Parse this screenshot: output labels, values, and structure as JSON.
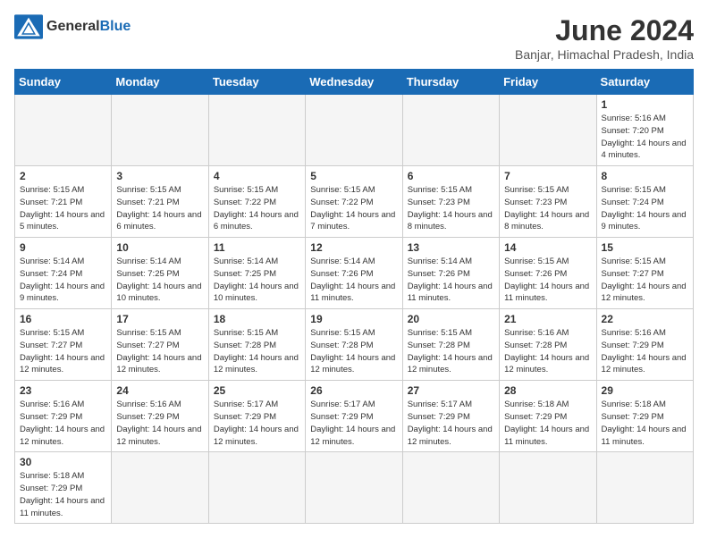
{
  "header": {
    "logo_general": "General",
    "logo_blue": "Blue",
    "month_year": "June 2024",
    "location": "Banjar, Himachal Pradesh, India"
  },
  "days_of_week": [
    "Sunday",
    "Monday",
    "Tuesday",
    "Wednesday",
    "Thursday",
    "Friday",
    "Saturday"
  ],
  "weeks": [
    [
      {
        "day": "",
        "sunrise": "",
        "sunset": "",
        "daylight": "",
        "empty": true
      },
      {
        "day": "",
        "sunrise": "",
        "sunset": "",
        "daylight": "",
        "empty": true
      },
      {
        "day": "",
        "sunrise": "",
        "sunset": "",
        "daylight": "",
        "empty": true
      },
      {
        "day": "",
        "sunrise": "",
        "sunset": "",
        "daylight": "",
        "empty": true
      },
      {
        "day": "",
        "sunrise": "",
        "sunset": "",
        "daylight": "",
        "empty": true
      },
      {
        "day": "",
        "sunrise": "",
        "sunset": "",
        "daylight": "",
        "empty": true
      },
      {
        "day": "1",
        "sunrise": "5:16 AM",
        "sunset": "7:20 PM",
        "daylight": "14 hours and 4 minutes.",
        "empty": false
      }
    ],
    [
      {
        "day": "2",
        "sunrise": "5:15 AM",
        "sunset": "7:21 PM",
        "daylight": "14 hours and 5 minutes.",
        "empty": false
      },
      {
        "day": "3",
        "sunrise": "5:15 AM",
        "sunset": "7:21 PM",
        "daylight": "14 hours and 6 minutes.",
        "empty": false
      },
      {
        "day": "4",
        "sunrise": "5:15 AM",
        "sunset": "7:22 PM",
        "daylight": "14 hours and 6 minutes.",
        "empty": false
      },
      {
        "day": "5",
        "sunrise": "5:15 AM",
        "sunset": "7:22 PM",
        "daylight": "14 hours and 7 minutes.",
        "empty": false
      },
      {
        "day": "6",
        "sunrise": "5:15 AM",
        "sunset": "7:23 PM",
        "daylight": "14 hours and 8 minutes.",
        "empty": false
      },
      {
        "day": "7",
        "sunrise": "5:15 AM",
        "sunset": "7:23 PM",
        "daylight": "14 hours and 8 minutes.",
        "empty": false
      },
      {
        "day": "8",
        "sunrise": "5:15 AM",
        "sunset": "7:24 PM",
        "daylight": "14 hours and 9 minutes.",
        "empty": false
      }
    ],
    [
      {
        "day": "9",
        "sunrise": "5:14 AM",
        "sunset": "7:24 PM",
        "daylight": "14 hours and 9 minutes.",
        "empty": false
      },
      {
        "day": "10",
        "sunrise": "5:14 AM",
        "sunset": "7:25 PM",
        "daylight": "14 hours and 10 minutes.",
        "empty": false
      },
      {
        "day": "11",
        "sunrise": "5:14 AM",
        "sunset": "7:25 PM",
        "daylight": "14 hours and 10 minutes.",
        "empty": false
      },
      {
        "day": "12",
        "sunrise": "5:14 AM",
        "sunset": "7:26 PM",
        "daylight": "14 hours and 11 minutes.",
        "empty": false
      },
      {
        "day": "13",
        "sunrise": "5:14 AM",
        "sunset": "7:26 PM",
        "daylight": "14 hours and 11 minutes.",
        "empty": false
      },
      {
        "day": "14",
        "sunrise": "5:15 AM",
        "sunset": "7:26 PM",
        "daylight": "14 hours and 11 minutes.",
        "empty": false
      },
      {
        "day": "15",
        "sunrise": "5:15 AM",
        "sunset": "7:27 PM",
        "daylight": "14 hours and 12 minutes.",
        "empty": false
      }
    ],
    [
      {
        "day": "16",
        "sunrise": "5:15 AM",
        "sunset": "7:27 PM",
        "daylight": "14 hours and 12 minutes.",
        "empty": false
      },
      {
        "day": "17",
        "sunrise": "5:15 AM",
        "sunset": "7:27 PM",
        "daylight": "14 hours and 12 minutes.",
        "empty": false
      },
      {
        "day": "18",
        "sunrise": "5:15 AM",
        "sunset": "7:28 PM",
        "daylight": "14 hours and 12 minutes.",
        "empty": false
      },
      {
        "day": "19",
        "sunrise": "5:15 AM",
        "sunset": "7:28 PM",
        "daylight": "14 hours and 12 minutes.",
        "empty": false
      },
      {
        "day": "20",
        "sunrise": "5:15 AM",
        "sunset": "7:28 PM",
        "daylight": "14 hours and 12 minutes.",
        "empty": false
      },
      {
        "day": "21",
        "sunrise": "5:16 AM",
        "sunset": "7:28 PM",
        "daylight": "14 hours and 12 minutes.",
        "empty": false
      },
      {
        "day": "22",
        "sunrise": "5:16 AM",
        "sunset": "7:29 PM",
        "daylight": "14 hours and 12 minutes.",
        "empty": false
      }
    ],
    [
      {
        "day": "23",
        "sunrise": "5:16 AM",
        "sunset": "7:29 PM",
        "daylight": "14 hours and 12 minutes.",
        "empty": false
      },
      {
        "day": "24",
        "sunrise": "5:16 AM",
        "sunset": "7:29 PM",
        "daylight": "14 hours and 12 minutes.",
        "empty": false
      },
      {
        "day": "25",
        "sunrise": "5:17 AM",
        "sunset": "7:29 PM",
        "daylight": "14 hours and 12 minutes.",
        "empty": false
      },
      {
        "day": "26",
        "sunrise": "5:17 AM",
        "sunset": "7:29 PM",
        "daylight": "14 hours and 12 minutes.",
        "empty": false
      },
      {
        "day": "27",
        "sunrise": "5:17 AM",
        "sunset": "7:29 PM",
        "daylight": "14 hours and 12 minutes.",
        "empty": false
      },
      {
        "day": "28",
        "sunrise": "5:18 AM",
        "sunset": "7:29 PM",
        "daylight": "14 hours and 11 minutes.",
        "empty": false
      },
      {
        "day": "29",
        "sunrise": "5:18 AM",
        "sunset": "7:29 PM",
        "daylight": "14 hours and 11 minutes.",
        "empty": false
      }
    ],
    [
      {
        "day": "30",
        "sunrise": "5:18 AM",
        "sunset": "7:29 PM",
        "daylight": "14 hours and 11 minutes.",
        "empty": false
      },
      {
        "day": "",
        "sunrise": "",
        "sunset": "",
        "daylight": "",
        "empty": true
      },
      {
        "day": "",
        "sunrise": "",
        "sunset": "",
        "daylight": "",
        "empty": true
      },
      {
        "day": "",
        "sunrise": "",
        "sunset": "",
        "daylight": "",
        "empty": true
      },
      {
        "day": "",
        "sunrise": "",
        "sunset": "",
        "daylight": "",
        "empty": true
      },
      {
        "day": "",
        "sunrise": "",
        "sunset": "",
        "daylight": "",
        "empty": true
      },
      {
        "day": "",
        "sunrise": "",
        "sunset": "",
        "daylight": "",
        "empty": true
      }
    ]
  ]
}
